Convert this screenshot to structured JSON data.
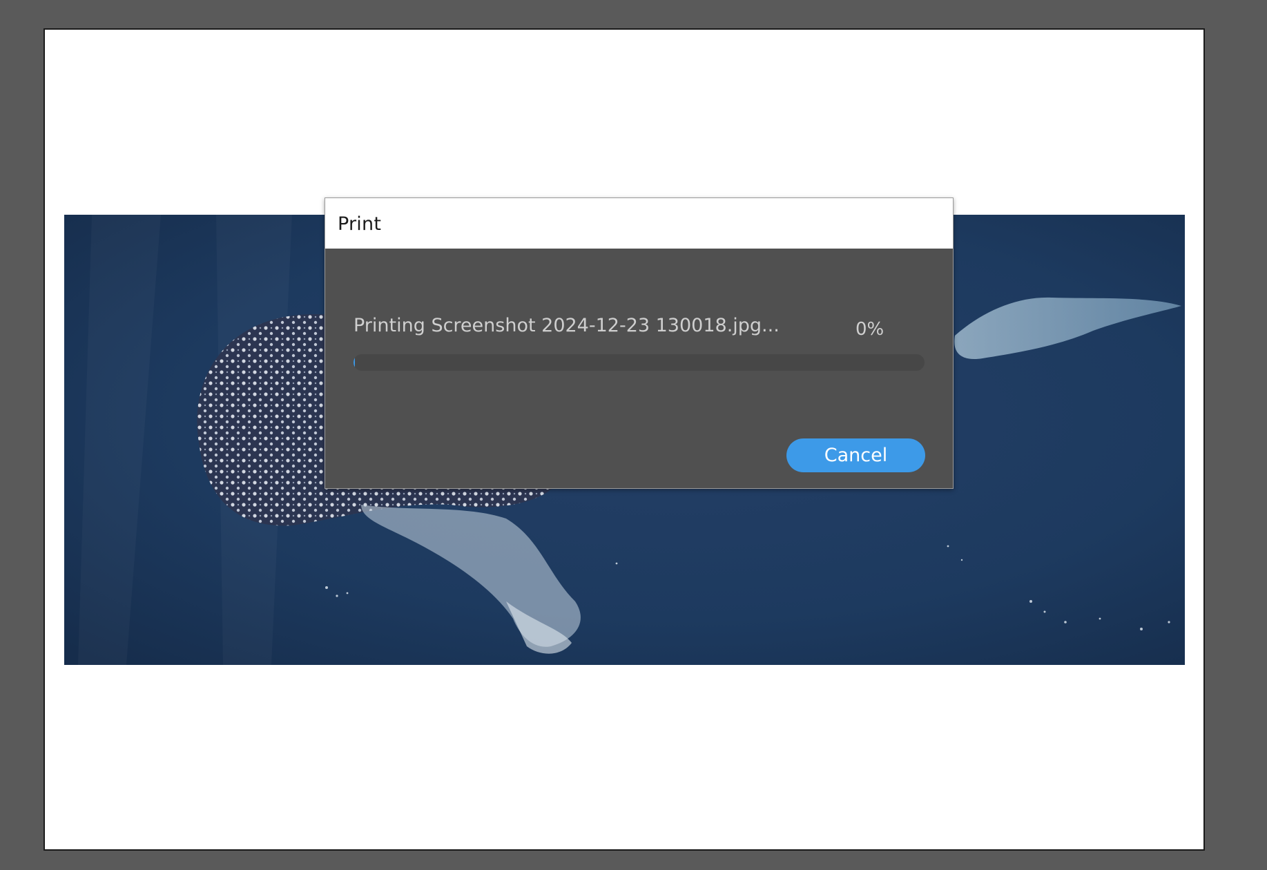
{
  "dialog": {
    "title": "Print",
    "status_text": "Printing Screenshot 2024-12-23 130018.jpg...",
    "progress_percent_label": "0%",
    "progress_fraction": 0.0,
    "cancel_label": "Cancel"
  },
  "colors": {
    "workspace_background": "#5a5a5a",
    "page_background": "#ffffff",
    "dialog_background": "#505050",
    "accent": "#3d9ae8",
    "photo_water": "#1d3a5f"
  }
}
